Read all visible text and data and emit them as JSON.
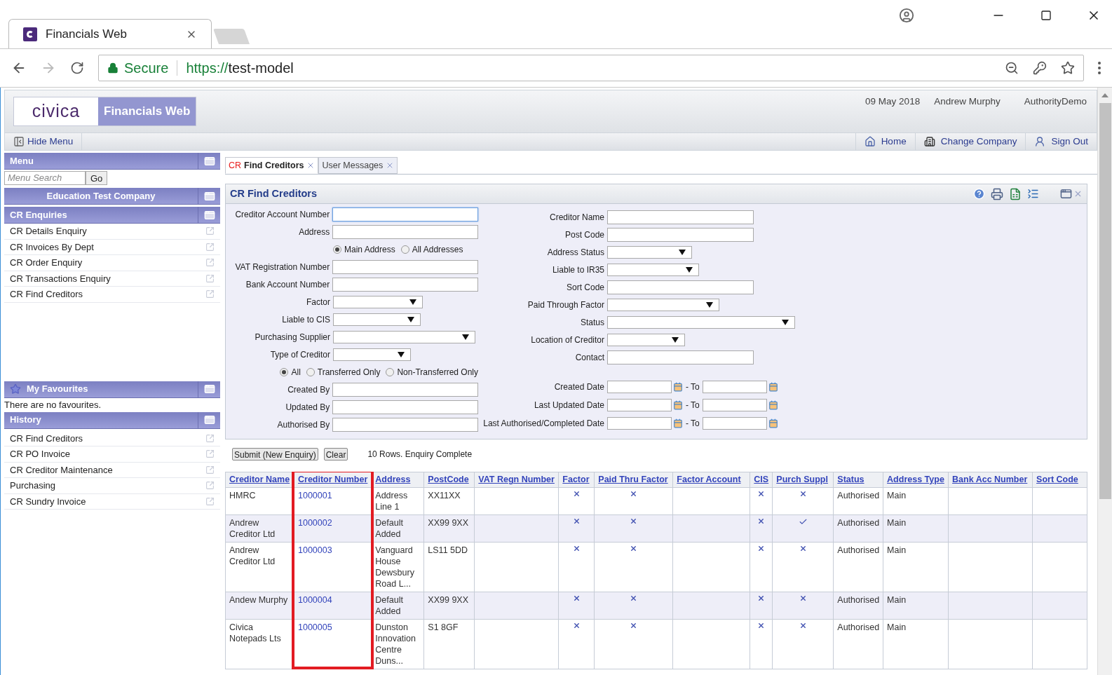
{
  "browser": {
    "tab_title": "Financials Web",
    "secure_label": "Secure",
    "url_scheme": "https://",
    "url_host": "test-model"
  },
  "header": {
    "logo": "civica",
    "app_name": "Financials Web",
    "date": "09 May 2018",
    "user": "Andrew Murphy",
    "company": "AuthorityDemo"
  },
  "toolbar": {
    "hide_menu": "Hide Menu",
    "nav": [
      {
        "kind": "home",
        "label": "Home"
      },
      {
        "kind": "company",
        "label": "Change Company"
      },
      {
        "kind": "signout",
        "label": "Sign Out"
      }
    ]
  },
  "sidebar": {
    "menu_title": "Menu",
    "search_placeholder": "Menu Search",
    "go": "Go",
    "company": "Education Test Company",
    "section": "CR Enquiries",
    "items": [
      "CR Details Enquiry",
      "CR Invoices By Dept",
      "CR Order Enquiry",
      "CR Transactions Enquiry",
      "CR Find Creditors"
    ],
    "favourites_title": "My Favourites",
    "favourites_empty": "There are no favourites.",
    "history_title": "History",
    "history": [
      "CR Find Creditors",
      "CR PO Invoice",
      "CR Creditor Maintenance",
      "Purchasing",
      "CR Sundry Invoice"
    ]
  },
  "tabs": [
    {
      "prefix": "CR",
      "label": "Find Creditors",
      "selected": true
    },
    {
      "label": "User Messages",
      "selected": false
    }
  ],
  "panel": {
    "title": "CR Find Creditors",
    "left": [
      {
        "kind": "text",
        "label": "Creditor Account Number",
        "focused": true
      },
      {
        "kind": "text",
        "label": "Address",
        "focused": false
      },
      {
        "kind": "radios",
        "options": [
          {
            "label": "Main Address",
            "selected": true
          },
          {
            "label": "All Addresses",
            "selected": false
          }
        ]
      },
      {
        "kind": "text",
        "label": "VAT Registration Number",
        "focused": false
      },
      {
        "kind": "text",
        "label": "Bank Account Number",
        "focused": false
      },
      {
        "kind": "select",
        "label": "Factor"
      },
      {
        "kind": "select",
        "label": "Liable to CIS"
      },
      {
        "kind": "select",
        "label": "Purchasing Supplier"
      },
      {
        "kind": "select",
        "label": "Type of Creditor"
      },
      {
        "kind": "radios",
        "options": [
          {
            "label": "All",
            "selected": true
          },
          {
            "label": "Transferred Only",
            "selected": false
          },
          {
            "label": "Non-Transferred Only",
            "selected": false
          }
        ]
      },
      {
        "kind": "text",
        "label": "Created By",
        "focused": false
      },
      {
        "kind": "text",
        "label": "Updated By",
        "focused": false
      },
      {
        "kind": "text",
        "label": "Authorised By",
        "focused": false
      }
    ],
    "right": [
      {
        "kind": "text",
        "label": "Creditor Name",
        "focused": false
      },
      {
        "kind": "text",
        "label": "Post Code",
        "focused": false
      },
      {
        "kind": "select",
        "label": "Address Status"
      },
      {
        "kind": "select",
        "label": "Liable to IR35"
      },
      {
        "kind": "text",
        "label": "Sort Code",
        "focused": false
      },
      {
        "kind": "select",
        "label": "Paid Through Factor"
      },
      {
        "kind": "select",
        "label": "Status"
      },
      {
        "kind": "select",
        "label": "Location of Creditor"
      },
      {
        "kind": "text",
        "label": "Contact",
        "focused": false
      },
      {
        "kind": "date_range",
        "label": "Created Date",
        "separator": "- To"
      },
      {
        "kind": "date_range",
        "label": "Last Updated Date",
        "separator": "- To"
      },
      {
        "kind": "date_range",
        "label": "Last Authorised/Completed Date",
        "separator": "- To"
      }
    ],
    "submit": "Submit (New Enquiry)",
    "clear": "Clear",
    "status": "10 Rows. Enquiry Complete"
  },
  "table": {
    "columns": [
      {
        "label": "Creditor Name",
        "highlighted": false
      },
      {
        "label": "Creditor Number",
        "highlighted": true
      },
      {
        "label": "Address",
        "highlighted": false
      },
      {
        "label": "PostCode",
        "highlighted": false
      },
      {
        "label": "VAT Regn Number",
        "highlighted": false
      },
      {
        "label": "Factor",
        "highlighted": false
      },
      {
        "label": "Paid Thru Factor",
        "highlighted": false
      },
      {
        "label": "Factor Account",
        "highlighted": false
      },
      {
        "label": "CIS",
        "highlighted": false
      },
      {
        "label": "Purch Suppl",
        "highlighted": false
      },
      {
        "label": "Status",
        "highlighted": false
      },
      {
        "label": "Address Type",
        "highlighted": false
      },
      {
        "label": "Bank Acc Number",
        "highlighted": false
      },
      {
        "label": "Sort Code",
        "highlighted": false
      }
    ],
    "rows": [
      {
        "cells": [
          {
            "kind": "text",
            "text": "HMRC"
          },
          {
            "kind": "link",
            "text": "1000001"
          },
          {
            "kind": "text",
            "text": "Address Line 1"
          },
          {
            "kind": "text",
            "text": "XX11XX"
          },
          {
            "kind": "blank"
          },
          {
            "kind": "flag",
            "checked": false
          },
          {
            "kind": "flag",
            "checked": false
          },
          {
            "kind": "blank"
          },
          {
            "kind": "flag",
            "checked": false
          },
          {
            "kind": "flag",
            "checked": false
          },
          {
            "kind": "text",
            "text": "Authorised"
          },
          {
            "kind": "text",
            "text": "Main"
          },
          {
            "kind": "blank"
          },
          {
            "kind": "blank"
          }
        ]
      },
      {
        "cells": [
          {
            "kind": "text",
            "text": "Andrew Creditor Ltd"
          },
          {
            "kind": "link",
            "text": "1000002"
          },
          {
            "kind": "text",
            "text": "Default Added"
          },
          {
            "kind": "text",
            "text": "XX99 9XX"
          },
          {
            "kind": "blank"
          },
          {
            "kind": "flag",
            "checked": false
          },
          {
            "kind": "flag",
            "checked": false
          },
          {
            "kind": "blank"
          },
          {
            "kind": "flag",
            "checked": false
          },
          {
            "kind": "flag",
            "checked": true
          },
          {
            "kind": "text",
            "text": "Authorised"
          },
          {
            "kind": "text",
            "text": "Main"
          },
          {
            "kind": "blank"
          },
          {
            "kind": "blank"
          }
        ]
      },
      {
        "cells": [
          {
            "kind": "text",
            "text": "Andrew Creditor Ltd"
          },
          {
            "kind": "link",
            "text": "1000003"
          },
          {
            "kind": "text",
            "text": "Vanguard House Dewsbury Road L..."
          },
          {
            "kind": "text",
            "text": "LS11 5DD"
          },
          {
            "kind": "blank"
          },
          {
            "kind": "flag",
            "checked": false
          },
          {
            "kind": "flag",
            "checked": false
          },
          {
            "kind": "blank"
          },
          {
            "kind": "flag",
            "checked": false
          },
          {
            "kind": "flag",
            "checked": false
          },
          {
            "kind": "text",
            "text": "Authorised"
          },
          {
            "kind": "text",
            "text": "Main"
          },
          {
            "kind": "blank"
          },
          {
            "kind": "blank"
          }
        ]
      },
      {
        "cells": [
          {
            "kind": "text",
            "text": "Andew Murphy"
          },
          {
            "kind": "link",
            "text": "1000004"
          },
          {
            "kind": "text",
            "text": "Default Added"
          },
          {
            "kind": "text",
            "text": "XX99 9XX"
          },
          {
            "kind": "blank"
          },
          {
            "kind": "flag",
            "checked": false
          },
          {
            "kind": "flag",
            "checked": false
          },
          {
            "kind": "blank"
          },
          {
            "kind": "flag",
            "checked": false
          },
          {
            "kind": "flag",
            "checked": false
          },
          {
            "kind": "text",
            "text": "Authorised"
          },
          {
            "kind": "text",
            "text": "Main"
          },
          {
            "kind": "blank"
          },
          {
            "kind": "blank"
          }
        ]
      },
      {
        "cells": [
          {
            "kind": "text",
            "text": "Civica Notepads Lts"
          },
          {
            "kind": "link",
            "text": "1000005"
          },
          {
            "kind": "text",
            "text": "Dunston Innovation Centre Duns..."
          },
          {
            "kind": "text",
            "text": "S1 8GF"
          },
          {
            "kind": "blank"
          },
          {
            "kind": "flag",
            "checked": false
          },
          {
            "kind": "flag",
            "checked": false
          },
          {
            "kind": "blank"
          },
          {
            "kind": "flag",
            "checked": false
          },
          {
            "kind": "flag",
            "checked": false
          },
          {
            "kind": "text",
            "text": "Authorised"
          },
          {
            "kind": "text",
            "text": "Main"
          },
          {
            "kind": "blank"
          },
          {
            "kind": "blank"
          }
        ]
      }
    ]
  }
}
